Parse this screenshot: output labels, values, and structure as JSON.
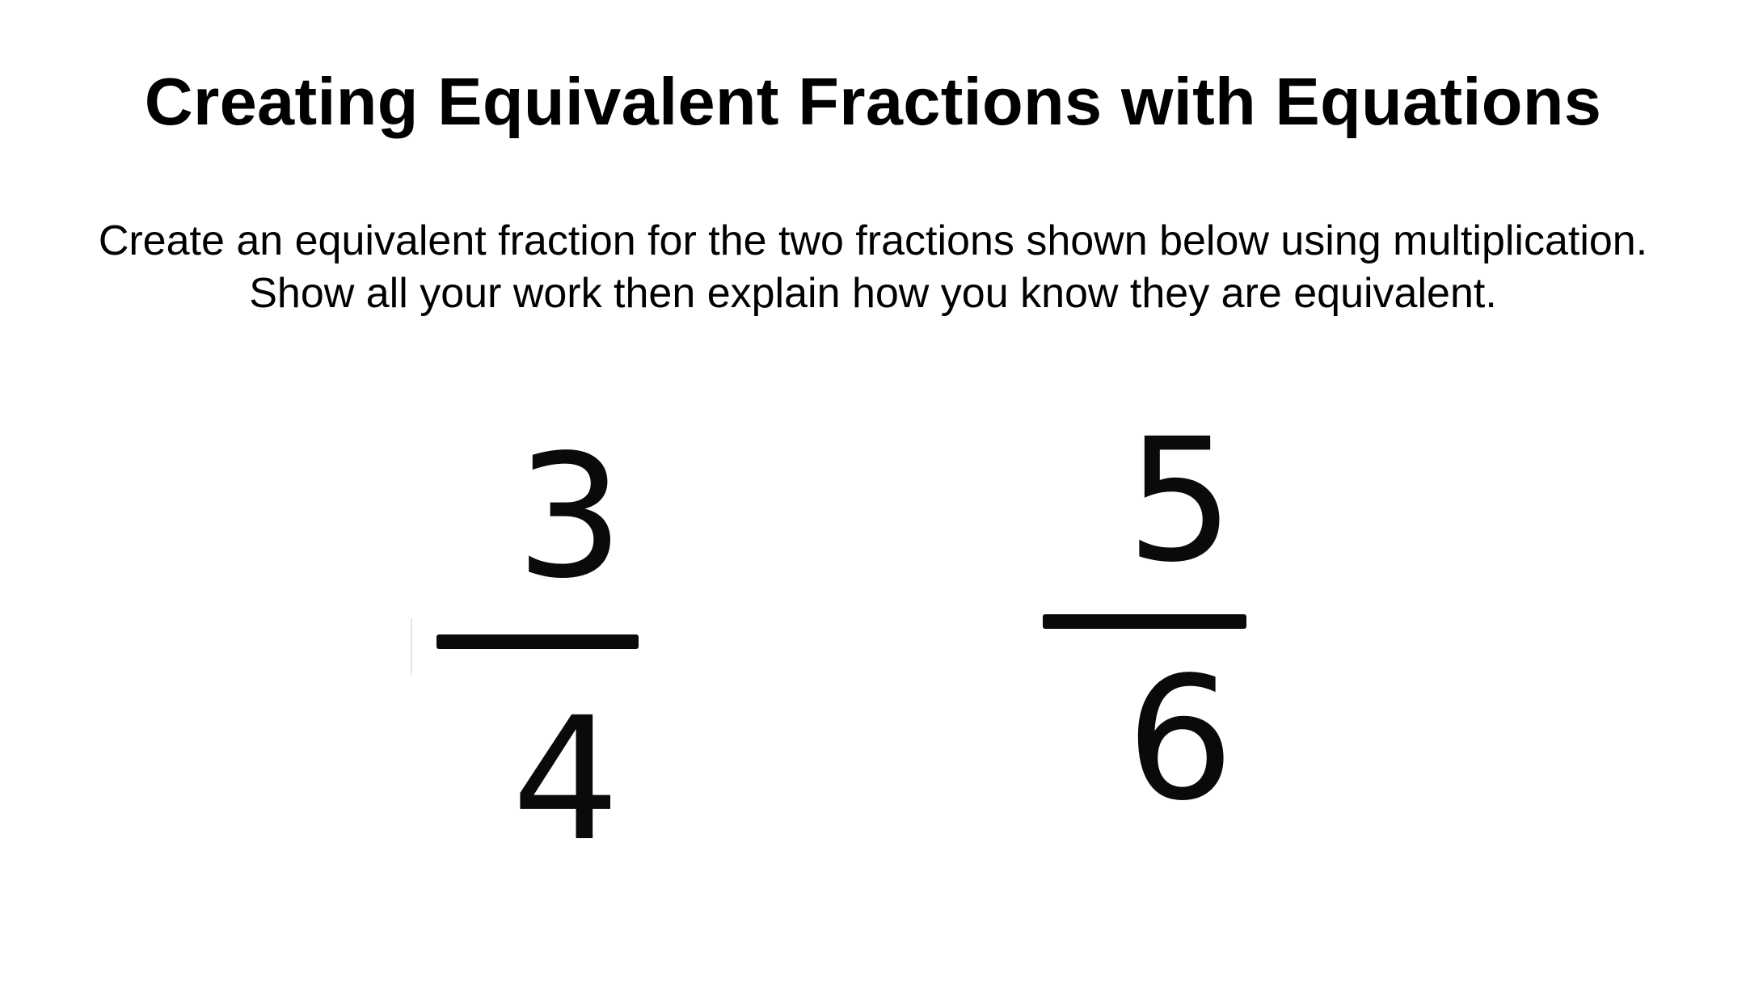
{
  "title": "Creating Equivalent Fractions with Equations",
  "instructions": {
    "line1": "Create an equivalent fraction for the two fractions shown below using multiplication.",
    "line2": "Show all your work then explain how you know they are equivalent."
  },
  "fractions": [
    {
      "numerator": "3",
      "denominator": "4"
    },
    {
      "numerator": "5",
      "denominator": "6"
    }
  ]
}
